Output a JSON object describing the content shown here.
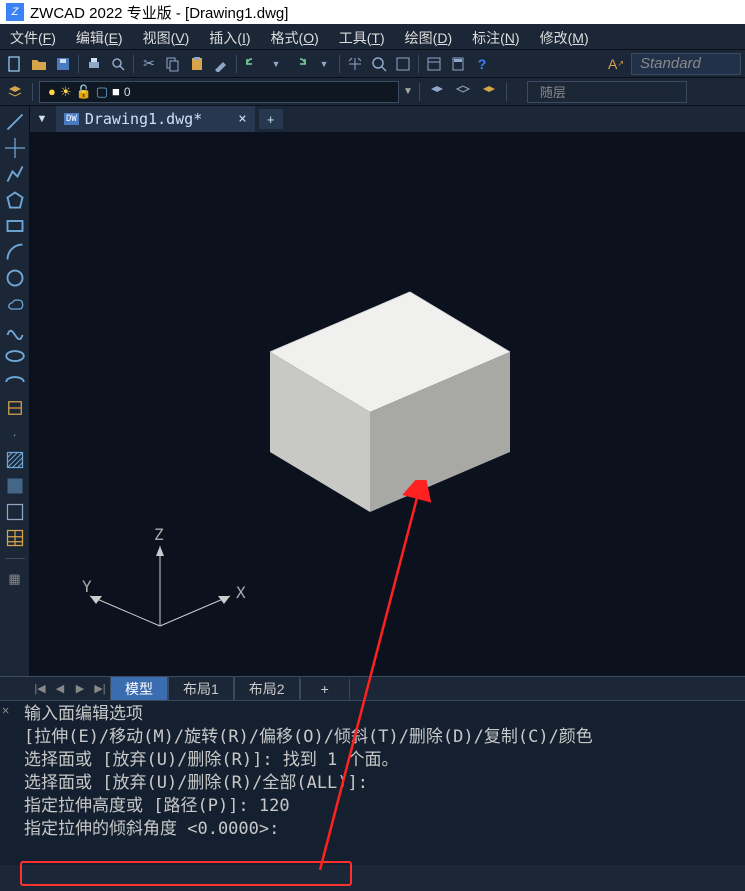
{
  "title": "ZWCAD 2022 专业版 - [Drawing1.dwg]",
  "menu": [
    {
      "label": "文件",
      "key": "F"
    },
    {
      "label": "编辑",
      "key": "E"
    },
    {
      "label": "视图",
      "key": "V"
    },
    {
      "label": "插入",
      "key": "I"
    },
    {
      "label": "格式",
      "key": "O"
    },
    {
      "label": "工具",
      "key": "T"
    },
    {
      "label": "绘图",
      "key": "D"
    },
    {
      "label": "标注",
      "key": "N"
    },
    {
      "label": "修改",
      "key": "M"
    }
  ],
  "style_field": "Standard",
  "layer": {
    "name": "0"
  },
  "follow_label": "随层",
  "file_tab": "Drawing1.dwg*",
  "layout_tabs": {
    "model": "模型",
    "layout1": "布局1",
    "layout2": "布局2",
    "add": "+"
  },
  "ucs": {
    "z": "Z",
    "x": "X",
    "y": "Y"
  },
  "cmd_lines": [
    "输入面编辑选项",
    "[拉伸(E)/移动(M)/旋转(R)/偏移(O)/倾斜(T)/删除(D)/复制(C)/颜色",
    "选择面或 [放弃(U)/删除(R)]:   找到 1 个面。",
    "选择面或 [放弃(U)/删除(R)/全部(ALL)]:",
    "指定拉伸高度或 [路径(P)]: 120",
    "指定拉伸的倾斜角度 <0.0000>:"
  ]
}
